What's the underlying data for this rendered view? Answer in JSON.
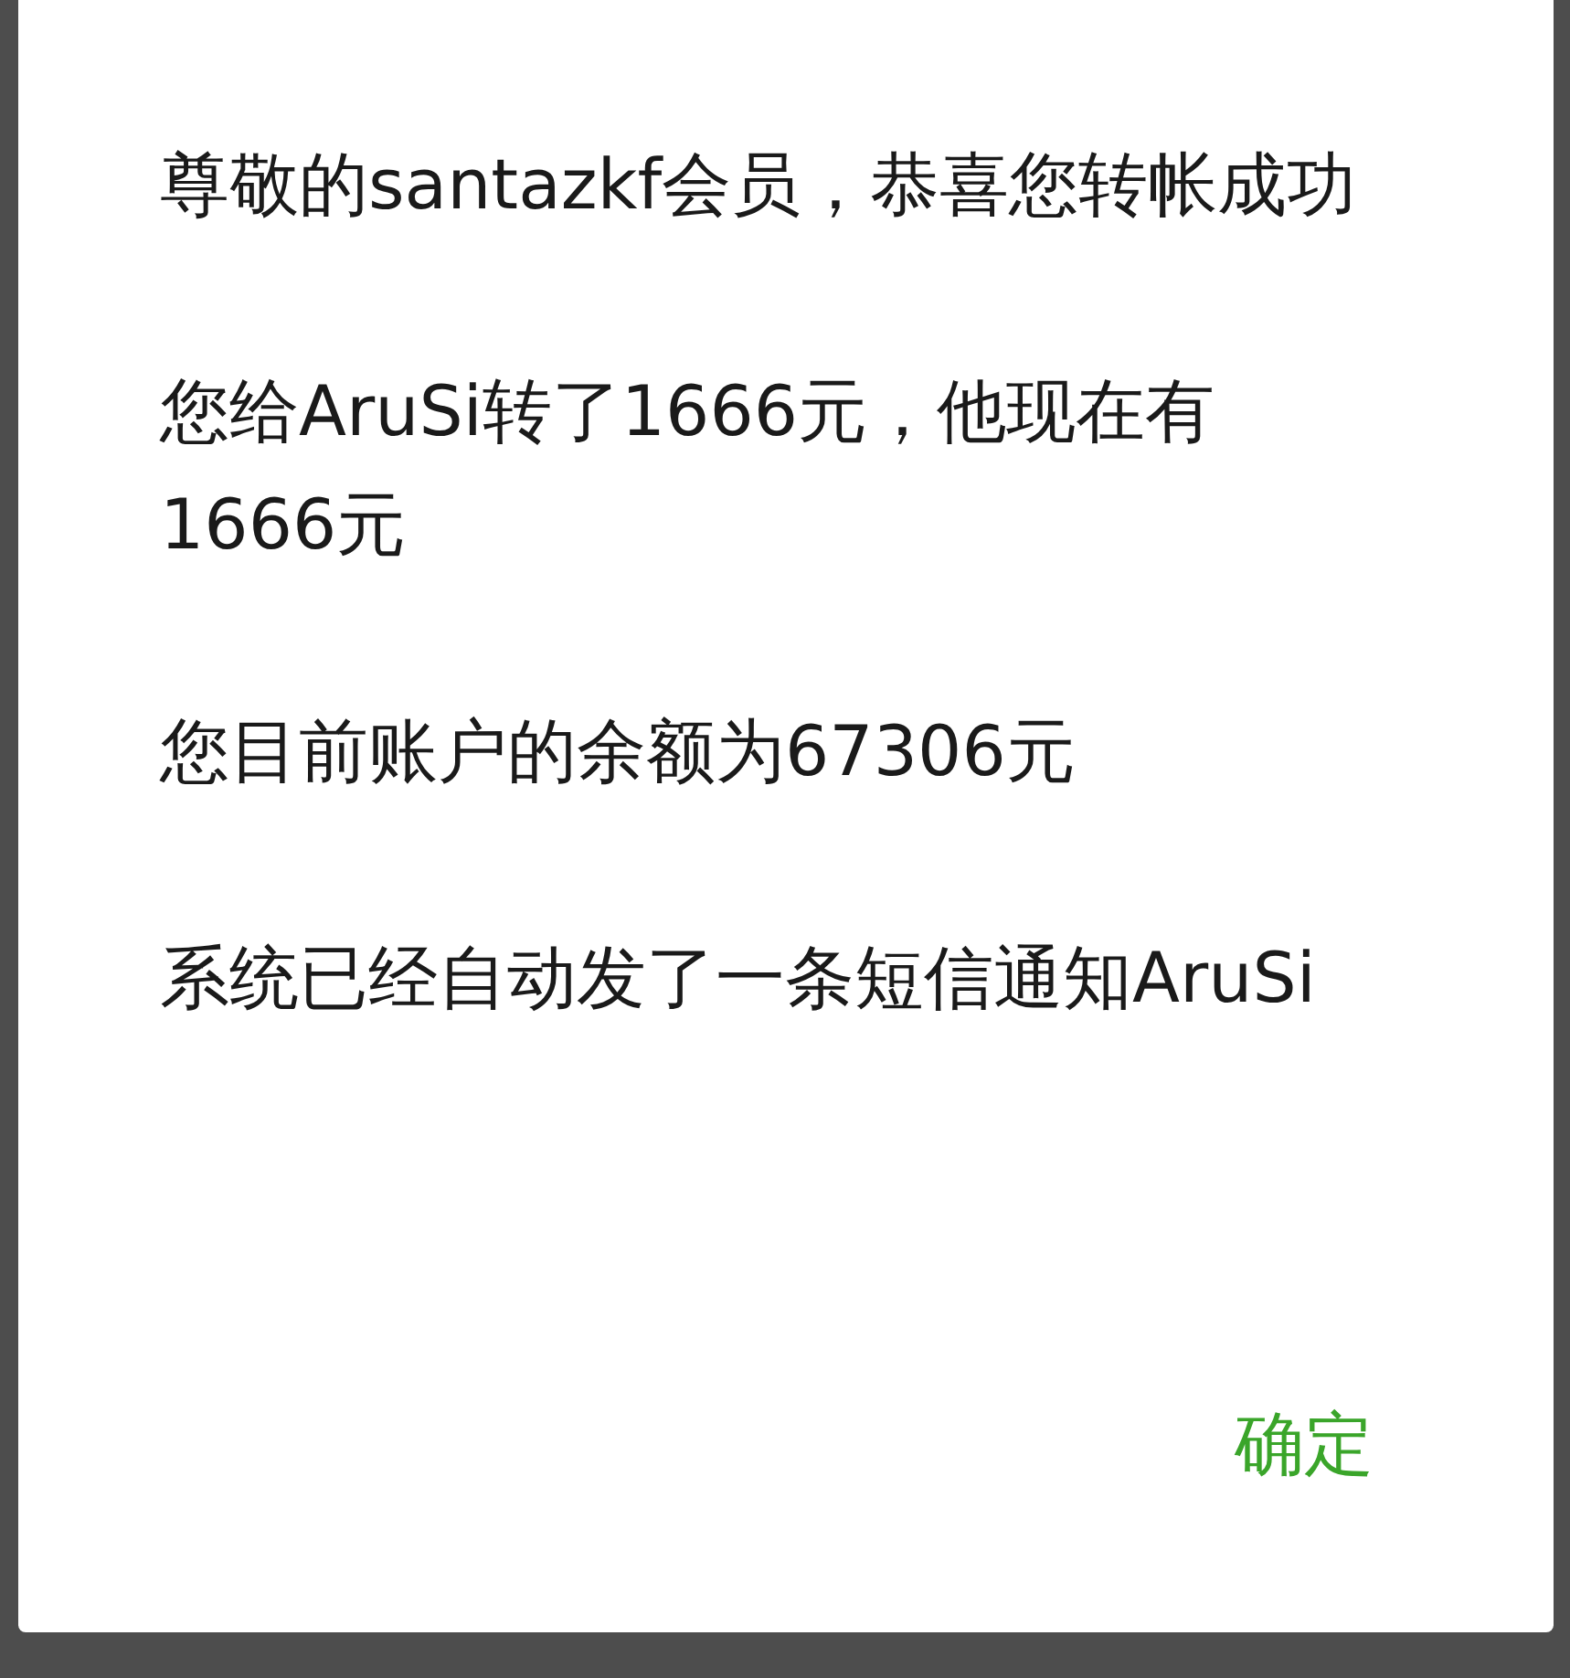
{
  "dialog": {
    "messages": [
      "尊敬的santazkf会员，恭喜您转帐成功",
      "您给AruSi转了1666元，他现在有1666元",
      "您目前账户的余额为67306元",
      "系统已经自动发了一条短信通知AruSi"
    ],
    "button": "确定"
  }
}
